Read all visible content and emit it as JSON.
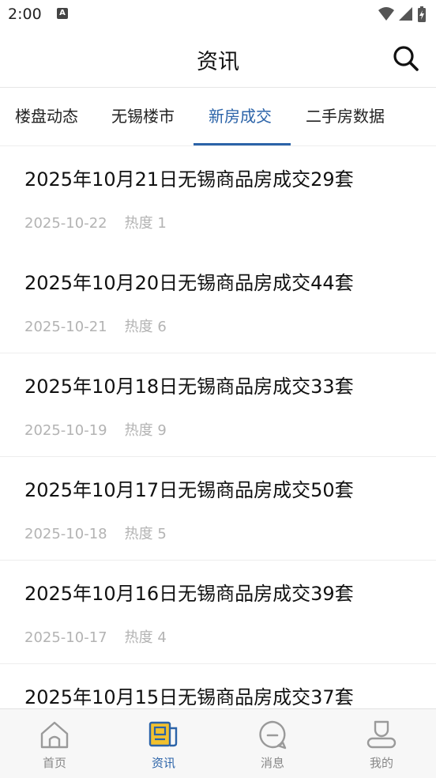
{
  "status_bar": {
    "time": "2:00",
    "notification_icon": "a-icon"
  },
  "header": {
    "title": "资讯",
    "search_icon": "search-icon"
  },
  "tabs": [
    {
      "label": "楼盘动态",
      "active": false
    },
    {
      "label": "无锡楼市",
      "active": false
    },
    {
      "label": "新房成交",
      "active": true
    },
    {
      "label": "二手房数据",
      "active": false
    }
  ],
  "articles": [
    {
      "title": "2025年10月21日无锡商品房成交29套",
      "date": "2025-10-22",
      "heat": "热度 1"
    },
    {
      "title": "2025年10月20日无锡商品房成交44套",
      "date": "2025-10-21",
      "heat": "热度 6"
    },
    {
      "title": "2025年10月18日无锡商品房成交33套",
      "date": "2025-10-19",
      "heat": "热度 9"
    },
    {
      "title": "2025年10月17日无锡商品房成交50套",
      "date": "2025-10-18",
      "heat": "热度 5"
    },
    {
      "title": "2025年10月16日无锡商品房成交39套",
      "date": "2025-10-17",
      "heat": "热度 4"
    },
    {
      "title": "2025年10月15日无锡商品房成交37套",
      "date": "",
      "heat": ""
    }
  ],
  "bottom_nav": [
    {
      "label": "首页",
      "icon": "home-icon",
      "active": false
    },
    {
      "label": "资讯",
      "icon": "news-icon",
      "active": true
    },
    {
      "label": "消息",
      "icon": "message-icon",
      "active": false
    },
    {
      "label": "我的",
      "icon": "profile-icon",
      "active": false
    }
  ],
  "colors": {
    "accent": "#2b63a8",
    "meta_text": "#b3b3b3",
    "news_icon_fill": "#f2c12e"
  }
}
